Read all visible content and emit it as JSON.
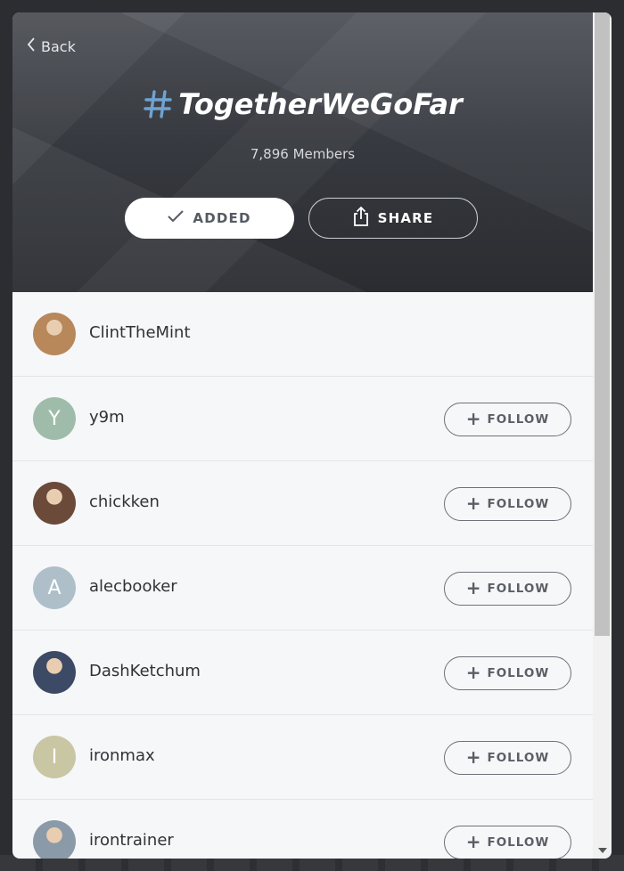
{
  "header": {
    "back_label": "Back",
    "title": "TogetherWeGoFar",
    "members": "7,896 Members",
    "added_label": "ADDED",
    "share_label": "SHARE"
  },
  "follow_label": "FOLLOW",
  "members": [
    {
      "name": "ClintTheMint",
      "initial": "",
      "avatar_color": "#b8875a",
      "photo": true,
      "followable": false
    },
    {
      "name": "y9m",
      "initial": "Y",
      "avatar_color": "#9fbcab",
      "photo": false,
      "followable": true
    },
    {
      "name": "chickken",
      "initial": "",
      "avatar_color": "#6b4a3a",
      "photo": true,
      "followable": true
    },
    {
      "name": "alecbooker",
      "initial": "A",
      "avatar_color": "#aebfc9",
      "photo": false,
      "followable": true
    },
    {
      "name": "DashKetchum",
      "initial": "",
      "avatar_color": "#3d4a66",
      "photo": true,
      "followable": true
    },
    {
      "name": "ironmax",
      "initial": "I",
      "avatar_color": "#c9c6a3",
      "photo": false,
      "followable": true
    },
    {
      "name": "irontrainer",
      "initial": "",
      "avatar_color": "#8a9aa8",
      "photo": true,
      "followable": true
    }
  ],
  "colors": {
    "hash_accent": "#6fa3d2",
    "header_dark": "#2c2e33",
    "list_bg": "#f6f7f9"
  }
}
